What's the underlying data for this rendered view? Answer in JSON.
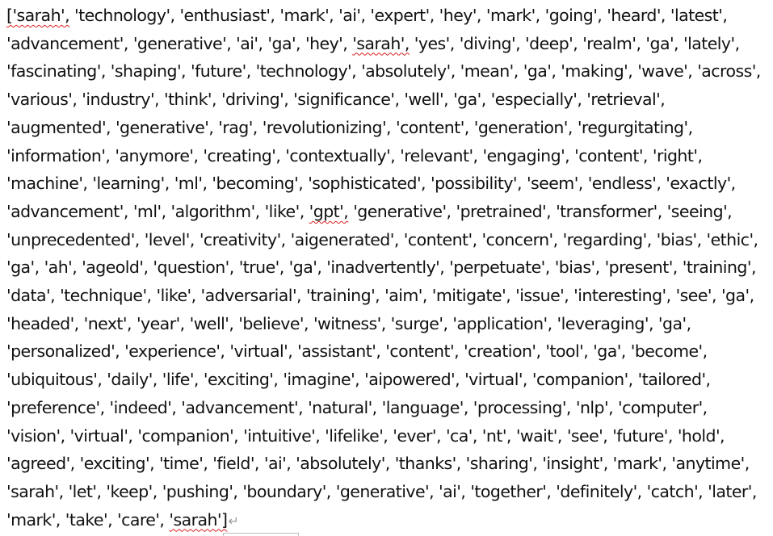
{
  "document": {
    "tokens": [
      {
        "text": "['sarah',",
        "spell": true
      },
      {
        "text": "'technology',"
      },
      {
        "text": "'enthusiast',"
      },
      {
        "text": "'mark',"
      },
      {
        "text": "'ai',"
      },
      {
        "text": "'expert',"
      },
      {
        "text": "'hey',"
      },
      {
        "text": "'mark',"
      },
      {
        "text": "'going',"
      },
      {
        "text": "'heard',"
      },
      {
        "text": "'latest',"
      },
      {
        "text": "'advancement',"
      },
      {
        "text": "'generative',"
      },
      {
        "text": "'ai',"
      },
      {
        "text": "'ga',"
      },
      {
        "text": "'hey',"
      },
      {
        "text": "'sarah',",
        "spell": true
      },
      {
        "text": "'yes',"
      },
      {
        "text": "'diving',"
      },
      {
        "text": "'deep',"
      },
      {
        "text": "'realm',"
      },
      {
        "text": "'ga',"
      },
      {
        "text": "'lately',"
      },
      {
        "text": "'fascinating',"
      },
      {
        "text": "'shaping',"
      },
      {
        "text": "'future',"
      },
      {
        "text": "'technology',"
      },
      {
        "text": "'absolutely',"
      },
      {
        "text": "'mean',"
      },
      {
        "text": "'ga',"
      },
      {
        "text": "'making',"
      },
      {
        "text": "'wave',"
      },
      {
        "text": "'across',"
      },
      {
        "text": "'various',"
      },
      {
        "text": "'industry',"
      },
      {
        "text": "'think',"
      },
      {
        "text": "'driving',"
      },
      {
        "text": "'significance',"
      },
      {
        "text": "'well',"
      },
      {
        "text": "'ga',"
      },
      {
        "text": "'especially',"
      },
      {
        "text": "'retrieval',"
      },
      {
        "text": "'augmented',"
      },
      {
        "text": "'generative',"
      },
      {
        "text": "'rag',"
      },
      {
        "text": "'revolutionizing',"
      },
      {
        "text": "'content',"
      },
      {
        "text": "'generation',"
      },
      {
        "text": "'regurgitating',"
      },
      {
        "text": "'information',"
      },
      {
        "text": "'anymore',"
      },
      {
        "text": "'creating',"
      },
      {
        "text": "'contextually',"
      },
      {
        "text": "'relevant',"
      },
      {
        "text": "'engaging',"
      },
      {
        "text": "'content',"
      },
      {
        "text": "'right',"
      },
      {
        "text": "'machine',"
      },
      {
        "text": "'learning',"
      },
      {
        "text": "'ml',"
      },
      {
        "text": "'becoming',"
      },
      {
        "text": "'sophisticated',"
      },
      {
        "text": "'possibility',"
      },
      {
        "text": "'seem',"
      },
      {
        "text": "'endless',"
      },
      {
        "text": "'exactly',"
      },
      {
        "text": "'advancement',"
      },
      {
        "text": "'ml',"
      },
      {
        "text": "'algorithm',"
      },
      {
        "text": "'like',"
      },
      {
        "text": "'gpt',",
        "spell": true
      },
      {
        "text": "'generative',"
      },
      {
        "text": "'pretrained',"
      },
      {
        "text": "'transformer',"
      },
      {
        "text": "'seeing',"
      },
      {
        "text": "'unprecedented',"
      },
      {
        "text": "'level',"
      },
      {
        "text": "'creativity',"
      },
      {
        "text": "'aigenerated',"
      },
      {
        "text": "'content',"
      },
      {
        "text": "'concern',"
      },
      {
        "text": "'regarding',"
      },
      {
        "text": "'bias',"
      },
      {
        "text": "'ethic',"
      },
      {
        "text": "'ga',"
      },
      {
        "text": "'ah',"
      },
      {
        "text": "'ageold',"
      },
      {
        "text": "'question',"
      },
      {
        "text": "'true',"
      },
      {
        "text": "'ga',"
      },
      {
        "text": "'inadvertently',"
      },
      {
        "text": "'perpetuate',"
      },
      {
        "text": "'bias',"
      },
      {
        "text": "'present',"
      },
      {
        "text": "'training',"
      },
      {
        "text": "'data',"
      },
      {
        "text": "'technique',"
      },
      {
        "text": "'like',"
      },
      {
        "text": "'adversarial',"
      },
      {
        "text": "'training',"
      },
      {
        "text": "'aim',"
      },
      {
        "text": "'mitigate',"
      },
      {
        "text": "'issue',"
      },
      {
        "text": "'interesting',"
      },
      {
        "text": "'see',"
      },
      {
        "text": "'ga',"
      },
      {
        "text": "'headed',"
      },
      {
        "text": "'next',"
      },
      {
        "text": "'year',"
      },
      {
        "text": "'well',"
      },
      {
        "text": "'believe',"
      },
      {
        "text": "'witness',"
      },
      {
        "text": "'surge',"
      },
      {
        "text": "'application',"
      },
      {
        "text": "'leveraging',"
      },
      {
        "text": "'ga',"
      },
      {
        "text": "'personalized',"
      },
      {
        "text": "'experience',"
      },
      {
        "text": "'virtual',"
      },
      {
        "text": "'assistant',"
      },
      {
        "text": "'content',"
      },
      {
        "text": "'creation',"
      },
      {
        "text": "'tool',"
      },
      {
        "text": "'ga',"
      },
      {
        "text": "'become',"
      },
      {
        "text": "'ubiquitous',"
      },
      {
        "text": "'daily',"
      },
      {
        "text": "'life',"
      },
      {
        "text": "'exciting',"
      },
      {
        "text": "'imagine',"
      },
      {
        "text": "'aipowered',"
      },
      {
        "text": "'virtual',"
      },
      {
        "text": "'companion',"
      },
      {
        "text": "'tailored',"
      },
      {
        "text": "'preference',"
      },
      {
        "text": "'indeed',"
      },
      {
        "text": "'advancement',"
      },
      {
        "text": "'natural',"
      },
      {
        "text": "'language',"
      },
      {
        "text": "'processing',"
      },
      {
        "text": "'nlp',"
      },
      {
        "text": "'computer',"
      },
      {
        "text": "'vision',"
      },
      {
        "text": "'virtual',"
      },
      {
        "text": "'companion',"
      },
      {
        "text": "'intuitive',"
      },
      {
        "text": "'lifelike',"
      },
      {
        "text": "'ever',"
      },
      {
        "text": "'ca',"
      },
      {
        "text": "'nt',"
      },
      {
        "text": "'wait',"
      },
      {
        "text": "'see',"
      },
      {
        "text": "'future',"
      },
      {
        "text": "'hold',"
      },
      {
        "text": "'agreed',"
      },
      {
        "text": "'exciting',"
      },
      {
        "text": "'time',"
      },
      {
        "text": "'field',"
      },
      {
        "text": "'ai',"
      },
      {
        "text": "'absolutely',"
      },
      {
        "text": "'thanks',"
      },
      {
        "text": "'sharing',"
      },
      {
        "text": "'insight',"
      },
      {
        "text": "'mark',"
      },
      {
        "text": "'anytime',"
      },
      {
        "text": "'sarah',"
      },
      {
        "text": "'let',"
      },
      {
        "text": "'keep',"
      },
      {
        "text": "'pushing',"
      },
      {
        "text": "'boundary',"
      },
      {
        "text": "'generative',"
      },
      {
        "text": "'ai',"
      },
      {
        "text": "'together',"
      },
      {
        "text": "'definitely',"
      },
      {
        "text": "'catch',"
      },
      {
        "text": "'later',"
      },
      {
        "text": "'mark',"
      },
      {
        "text": "'take',"
      },
      {
        "text": "'care',"
      },
      {
        "text": "'sarah']",
        "spell": true
      }
    ],
    "paragraph_mark": "↵"
  },
  "colors": {
    "text": "#111111",
    "spellcheck_underline": "#dd2222",
    "paragraph_mark": "#9a9a9a"
  }
}
